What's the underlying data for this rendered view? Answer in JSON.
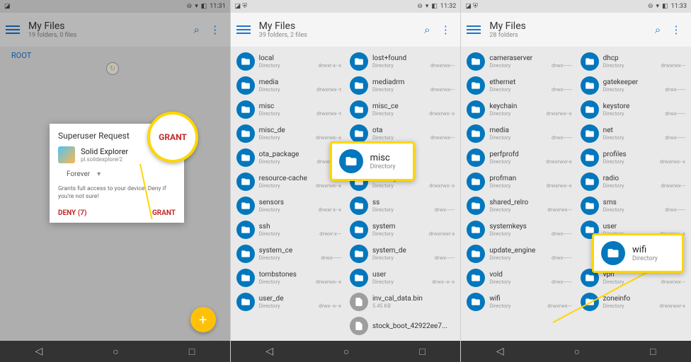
{
  "panel1": {
    "status_time": "11:31",
    "app_title": "My Files",
    "app_sub": "19 folders, 0 files",
    "root_label": "ROOT",
    "dialog": {
      "title": "Superuser Request",
      "app_name": "Solid Explorer",
      "app_pkg": "pl.solidexplorer2",
      "duration": "Forever",
      "msg": "Grants full access to your device. Deny if you're not sure!",
      "deny": "DENY (7)",
      "grant": "GRANT"
    },
    "badge_text": "GRANT"
  },
  "panel2": {
    "status_time": "11:32",
    "app_title": "My Files",
    "app_sub": "39 folders, 2 files",
    "callout": {
      "name": "misc",
      "sub": "Directory"
    },
    "items": [
      {
        "n": "local",
        "m": "Directory",
        "p": "drwxr-x--x"
      },
      {
        "n": "lost+found",
        "m": "Directory",
        "p": "drwxrwx---"
      },
      {
        "n": "media",
        "m": "Directory",
        "p": "drwxrwx--t"
      },
      {
        "n": "mediadrm",
        "m": "Directory",
        "p": "drwxrwx---"
      },
      {
        "n": "misc",
        "m": "Directory",
        "p": "drwxrwx--t"
      },
      {
        "n": "misc_ce",
        "m": "Directory",
        "p": "drwxrwx--x"
      },
      {
        "n": "misc_de",
        "m": "Directory",
        "p": "drwxrwx--x"
      },
      {
        "n": "ota",
        "m": "Directory",
        "p": "drwxrwx---"
      },
      {
        "n": "ota_package",
        "m": "Directory",
        "p": "drwxrwx---"
      },
      {
        "n": "",
        "m": "",
        "p": ""
      },
      {
        "n": "resource-cache",
        "m": "Directory",
        "p": "drwxrwx--x"
      },
      {
        "n": "security",
        "m": "Directory",
        "p": "drwxrwx--x"
      },
      {
        "n": "sensors",
        "m": "Directory",
        "p": "drwxr-x--x"
      },
      {
        "n": "ss",
        "m": "Directory",
        "p": "drwx------"
      },
      {
        "n": "ssh",
        "m": "Directory",
        "p": "drwxr-x---"
      },
      {
        "n": "system",
        "m": "Directory",
        "p": "drwxrwxr-x"
      },
      {
        "n": "system_ce",
        "m": "Directory",
        "p": "drwx------"
      },
      {
        "n": "system_de",
        "m": "Directory",
        "p": "drwx------"
      },
      {
        "n": "tombstones",
        "m": "Directory",
        "p": "drwxrwx--x"
      },
      {
        "n": "user",
        "m": "Directory",
        "p": "drwx--x--x"
      },
      {
        "n": "user_de",
        "m": "Directory",
        "p": "drwx--x--x"
      },
      {
        "n": "inv_cal_data.bin",
        "m": "5.45 KB",
        "p": "",
        "file": true
      },
      {
        "n": "",
        "m": "",
        "p": ""
      },
      {
        "n": "stock_boot_42922ee7...",
        "m": "",
        "p": "",
        "file": true
      }
    ]
  },
  "panel3": {
    "status_time": "11:33",
    "app_title": "My Files",
    "app_sub": "28 folders",
    "callout": {
      "name": "wifi",
      "sub": "Directory"
    },
    "items": [
      {
        "n": "cameraserver",
        "m": "Directory",
        "p": "drwx------"
      },
      {
        "n": "dhcp",
        "m": "Directory",
        "p": "drwxrwx---"
      },
      {
        "n": "ethernet",
        "m": "Directory",
        "p": "drwx------"
      },
      {
        "n": "gatekeeper",
        "m": "Directory",
        "p": "drwx------"
      },
      {
        "n": "keychain",
        "m": "Directory",
        "p": "drwxrwx--x"
      },
      {
        "n": "keystore",
        "m": "Directory",
        "p": "drwx------"
      },
      {
        "n": "media",
        "m": "Directory",
        "p": "drwx------"
      },
      {
        "n": "net",
        "m": "Directory",
        "p": "drwx------"
      },
      {
        "n": "perfprofd",
        "m": "Directory",
        "p": "drwxrwxr-x"
      },
      {
        "n": "profiles",
        "m": "Directory",
        "p": "drwxrwx--x"
      },
      {
        "n": "profman",
        "m": "Directory",
        "p": "drwxrwx--x"
      },
      {
        "n": "radio",
        "m": "Directory",
        "p": "drwxrwx---"
      },
      {
        "n": "shared_relro",
        "m": "Directory",
        "p": "drwxrwx---"
      },
      {
        "n": "sms",
        "m": "Directory",
        "p": "drwx------"
      },
      {
        "n": "systemkeys",
        "m": "Directory",
        "p": "drwx------"
      },
      {
        "n": "user",
        "m": "Directory",
        "p": "drwxrwx--x"
      },
      {
        "n": "update_engine",
        "m": "Directory",
        "p": "drwx------"
      },
      {
        "n": "",
        "m": "",
        "p": ""
      },
      {
        "n": "vold",
        "m": "Directory",
        "p": "drwx------"
      },
      {
        "n": "vpn",
        "m": "Directory",
        "p": "drwxrwx---"
      },
      {
        "n": "wifi",
        "m": "Directory",
        "p": "drwxrwx---"
      },
      {
        "n": "zoneinfo",
        "m": "Directory",
        "p": "drwxrwxr-x"
      }
    ]
  }
}
